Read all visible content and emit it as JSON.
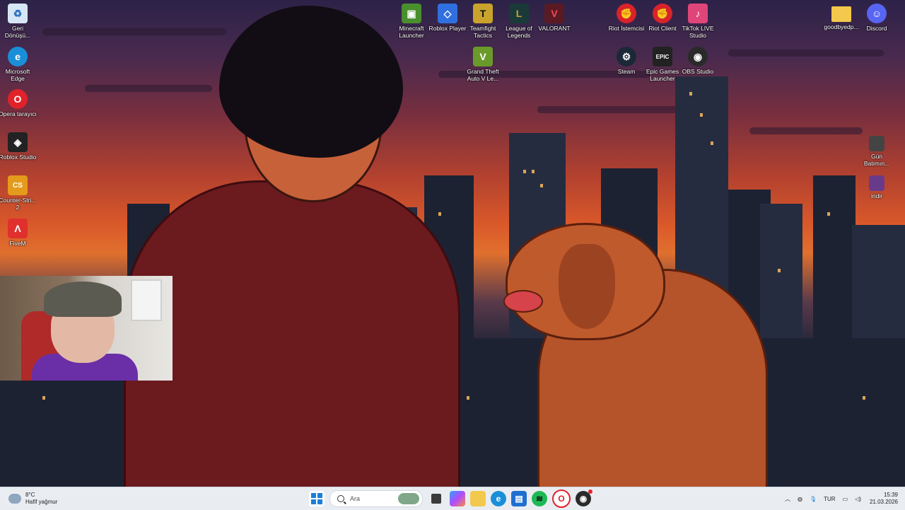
{
  "desktop_icons_left": [
    {
      "name": "recycle-bin-icon",
      "label": "Geri Dönüşü...",
      "color": "#d7e6f5",
      "glyph": "♻"
    },
    {
      "name": "edge-icon",
      "label": "Microsoft Edge",
      "color": "#1a8fd8",
      "glyph": "e"
    },
    {
      "name": "opera-icon",
      "label": "Opera tarayıcı",
      "color": "#e0222a",
      "glyph": "O"
    },
    {
      "name": "roblox-studio-icon",
      "label": "Roblox Studio",
      "color": "#222222",
      "glyph": "◈"
    },
    {
      "name": "counter-strike-icon",
      "label": "Counter-Stri... 2",
      "color": "#e49b1c",
      "glyph": "CS"
    },
    {
      "name": "fivem-icon",
      "label": "FiveM",
      "color": "#e0302d",
      "glyph": "Λ"
    }
  ],
  "desktop_icons_top": [
    {
      "name": "minecraft-launcher-icon",
      "label": "Minecraft Launcher",
      "color": "#4a8f2e",
      "glyph": "▣"
    },
    {
      "name": "roblox-player-icon",
      "label": "Roblox Player",
      "color": "#2f6fe0",
      "glyph": "◇"
    },
    {
      "name": "teamfight-tactics-icon",
      "label": "Teamfight Tactics",
      "color": "#c9a32c",
      "glyph": "T"
    },
    {
      "name": "league-of-legends-icon",
      "label": "League of Legends",
      "color": "#1a3a3a",
      "glyph": "L"
    },
    {
      "name": "valorant-icon",
      "label": "VALORANT",
      "color": "#5a1a24",
      "glyph": "V"
    },
    {
      "name": "gta-v-icon",
      "label": "Grand Theft Auto V Le...",
      "color": "#6a9a2a",
      "glyph": "V"
    }
  ],
  "desktop_icons_right": [
    {
      "name": "riot-istemcisi-icon",
      "label": "Riot İstemcisi",
      "color": "#d8232a",
      "glyph": "✊"
    },
    {
      "name": "riot-client-icon",
      "label": "Riot Client",
      "color": "#d8232a",
      "glyph": "✊"
    },
    {
      "name": "tiktok-live-studio-icon",
      "label": "TikTok LIVE Studio",
      "color": "#e0457a",
      "glyph": "♪"
    },
    {
      "name": "steam-icon",
      "label": "Steam",
      "color": "#1b2838",
      "glyph": "⚙"
    },
    {
      "name": "epic-games-icon",
      "label": "Epic Games Launcher",
      "color": "#222222",
      "glyph": "EPIC"
    },
    {
      "name": "obs-studio-icon",
      "label": "OBS Studio",
      "color": "#2a2a2a",
      "glyph": "◉"
    },
    {
      "name": "folder-icon",
      "label": "goodbyedp...",
      "color": "#f2c94c",
      "glyph": ""
    },
    {
      "name": "discord-icon",
      "label": "Discord",
      "color": "#5865f2",
      "glyph": "☺"
    },
    {
      "name": "gun-batimin-icon",
      "label": "Gün Batımın...",
      "color": "#444444",
      "glyph": ""
    },
    {
      "name": "indir-icon",
      "label": "indir",
      "color": "#6a3a8a",
      "glyph": ""
    }
  ],
  "taskbar": {
    "weather_temp": "8°C",
    "weather_desc": "Hafif yağmur",
    "search_placeholder": "Ara",
    "language": "TUR",
    "time": "15:39",
    "date": "21.03.2026"
  }
}
